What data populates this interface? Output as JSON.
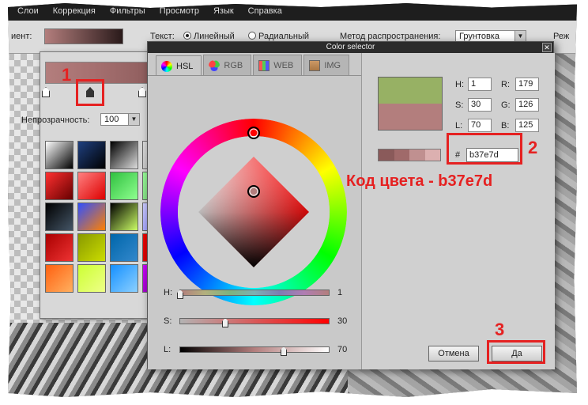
{
  "menubar": [
    "Слои",
    "Коррекция",
    "Фильтры",
    "Просмотр",
    "Язык",
    "Справка"
  ],
  "options": {
    "gradient_label": "иент:",
    "text_label": "Текст:",
    "linear": "Линейный",
    "radial": "Радиальный",
    "spread_label": "Метод распространения:",
    "spread_value": "Грунтовка",
    "extra_label": "Реж"
  },
  "gradient_panel": {
    "opacity_label": "Непрозрачность:",
    "opacity_value": "100"
  },
  "dialog": {
    "title": "Color selector",
    "tabs": [
      {
        "label": "HSL",
        "active": true,
        "icon": "color-wheel-icon"
      },
      {
        "label": "RGB",
        "active": false,
        "icon": "rgb-circles-icon"
      },
      {
        "label": "WEB",
        "active": false,
        "icon": "grid-palette-icon"
      },
      {
        "label": "IMG",
        "active": false,
        "icon": "image-icon"
      }
    ],
    "sliders": {
      "h": {
        "label": "H:",
        "value": "1"
      },
      "s": {
        "label": "S:",
        "value": "30"
      },
      "l": {
        "label": "L:",
        "value": "70"
      }
    },
    "fields": {
      "h": {
        "label": "H:",
        "value": "1"
      },
      "s": {
        "label": "S:",
        "value": "30"
      },
      "l": {
        "label": "L:",
        "value": "70"
      },
      "r": {
        "label": "R:",
        "value": "179"
      },
      "g": {
        "label": "G:",
        "value": "126"
      },
      "b": {
        "label": "B:",
        "value": "125"
      }
    },
    "hex_label": "#",
    "hex_value": "b37e7d",
    "cancel": "Отмена",
    "ok": "Да"
  },
  "colors": {
    "selected": "#b37e7d",
    "new_swatch": "#97b164",
    "annotation": "#e52121"
  },
  "annotations": {
    "n1": "1",
    "n2": "2",
    "n3": "3",
    "note": "Код цвета - b37e7d"
  }
}
